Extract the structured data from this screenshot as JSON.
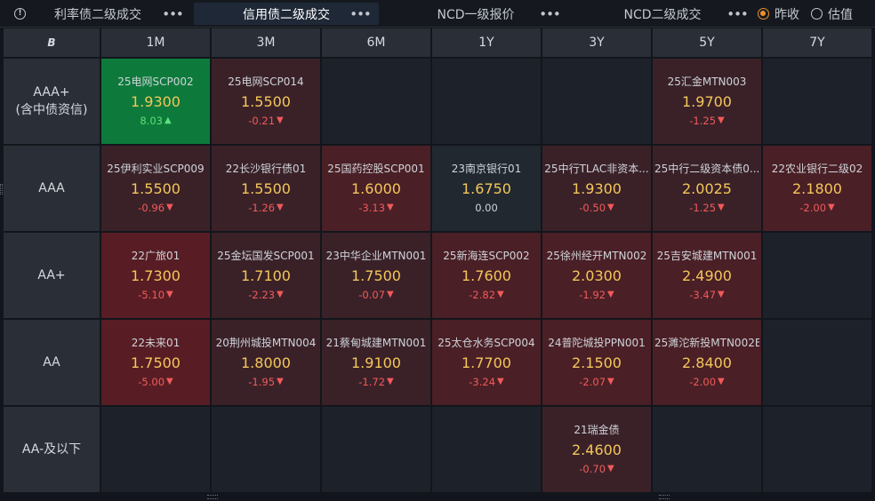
{
  "tabs": [
    {
      "label": "利率债二级成交",
      "active": false
    },
    {
      "label": "信用债二级成交",
      "active": true
    },
    {
      "label": "NCD一级报价",
      "active": false
    },
    {
      "label": "NCD二级成交",
      "active": false
    }
  ],
  "radio": {
    "option1": "昨收",
    "option2": "估值",
    "selected": "昨收"
  },
  "icons": {
    "info": "info-icon",
    "more": "more-dots-icon",
    "corner": "B"
  },
  "colors": {
    "up": "#5ce07a",
    "down": "#f25a5a",
    "price": "#f3c75a",
    "accent": "#e8902e"
  },
  "columns": [
    "1M",
    "3M",
    "6M",
    "1Y",
    "3Y",
    "5Y",
    "7Y"
  ],
  "rows": [
    {
      "label1": "AAA+",
      "label2": "(含中债资信)",
      "cells": [
        {
          "name": "25电网SCP002",
          "price": "1.9300",
          "chg": "8.03",
          "dir": "up",
          "tone": "green"
        },
        {
          "name": "25电网SCP014",
          "price": "1.5500",
          "chg": "-0.21",
          "dir": "down",
          "tone": "r1"
        },
        null,
        null,
        null,
        {
          "name": "25汇金MTN003",
          "price": "1.9700",
          "chg": "-1.25",
          "dir": "down",
          "tone": "r1"
        },
        null
      ]
    },
    {
      "label1": "AAA",
      "label2": "",
      "cells": [
        {
          "name": "25伊利实业SCP009",
          "price": "1.5500",
          "chg": "-0.96",
          "dir": "down",
          "tone": "r1"
        },
        {
          "name": "22长沙银行债01",
          "price": "1.5500",
          "chg": "-1.26",
          "dir": "down",
          "tone": "r1"
        },
        {
          "name": "25国药控股SCP001",
          "price": "1.6000",
          "chg": "-3.13",
          "dir": "down",
          "tone": "r2"
        },
        {
          "name": "23南京银行01",
          "price": "1.6750",
          "chg": "0.00",
          "dir": "flat",
          "tone": "neutral"
        },
        {
          "name": "25中行TLAC非资本...",
          "price": "1.9300",
          "chg": "-0.50",
          "dir": "down",
          "tone": "r1"
        },
        {
          "name": "25中行二级资本债0...",
          "price": "2.0025",
          "chg": "-1.25",
          "dir": "down",
          "tone": "r1"
        },
        {
          "name": "22农业银行二级02",
          "price": "2.1800",
          "chg": "-2.00",
          "dir": "down",
          "tone": "r2"
        }
      ]
    },
    {
      "label1": "AA+",
      "label2": "",
      "cells": [
        {
          "name": "22广旅01",
          "price": "1.7300",
          "chg": "-5.10",
          "dir": "down",
          "tone": "r3"
        },
        {
          "name": "25金坛国发SCP001",
          "price": "1.7100",
          "chg": "-2.23",
          "dir": "down",
          "tone": "r1"
        },
        {
          "name": "23中华企业MTN001",
          "price": "1.7500",
          "chg": "-0.07",
          "dir": "down",
          "tone": "r1"
        },
        {
          "name": "25新海连SCP002",
          "price": "1.7600",
          "chg": "-2.82",
          "dir": "down",
          "tone": "r2"
        },
        {
          "name": "25徐州经开MTN002",
          "price": "2.0300",
          "chg": "-1.92",
          "dir": "down",
          "tone": "r2"
        },
        {
          "name": "25吉安城建MTN001",
          "price": "2.4900",
          "chg": "-3.47",
          "dir": "down",
          "tone": "r2"
        },
        null
      ]
    },
    {
      "label1": "AA",
      "label2": "",
      "cells": [
        {
          "name": "22未来01",
          "price": "1.7500",
          "chg": "-5.00",
          "dir": "down",
          "tone": "r3"
        },
        {
          "name": "20荆州城投MTN004",
          "price": "1.8000",
          "chg": "-1.95",
          "dir": "down",
          "tone": "r1"
        },
        {
          "name": "21蔡甸城建MTN001",
          "price": "1.9100",
          "chg": "-1.72",
          "dir": "down",
          "tone": "r1"
        },
        {
          "name": "25太仓水务SCP004",
          "price": "1.7700",
          "chg": "-3.24",
          "dir": "down",
          "tone": "r2"
        },
        {
          "name": "24普陀城投PPN001",
          "price": "2.1500",
          "chg": "-2.07",
          "dir": "down",
          "tone": "r2"
        },
        {
          "name": "25濉沱新投MTN002E",
          "price": "2.8400",
          "chg": "-2.00",
          "dir": "down",
          "tone": "r2"
        },
        null
      ]
    },
    {
      "label1": "AA-及以下",
      "label2": "",
      "cells": [
        null,
        null,
        null,
        null,
        {
          "name": "21瑞金债",
          "price": "2.4600",
          "chg": "-0.70",
          "dir": "down",
          "tone": "r1"
        },
        null,
        null
      ]
    }
  ]
}
